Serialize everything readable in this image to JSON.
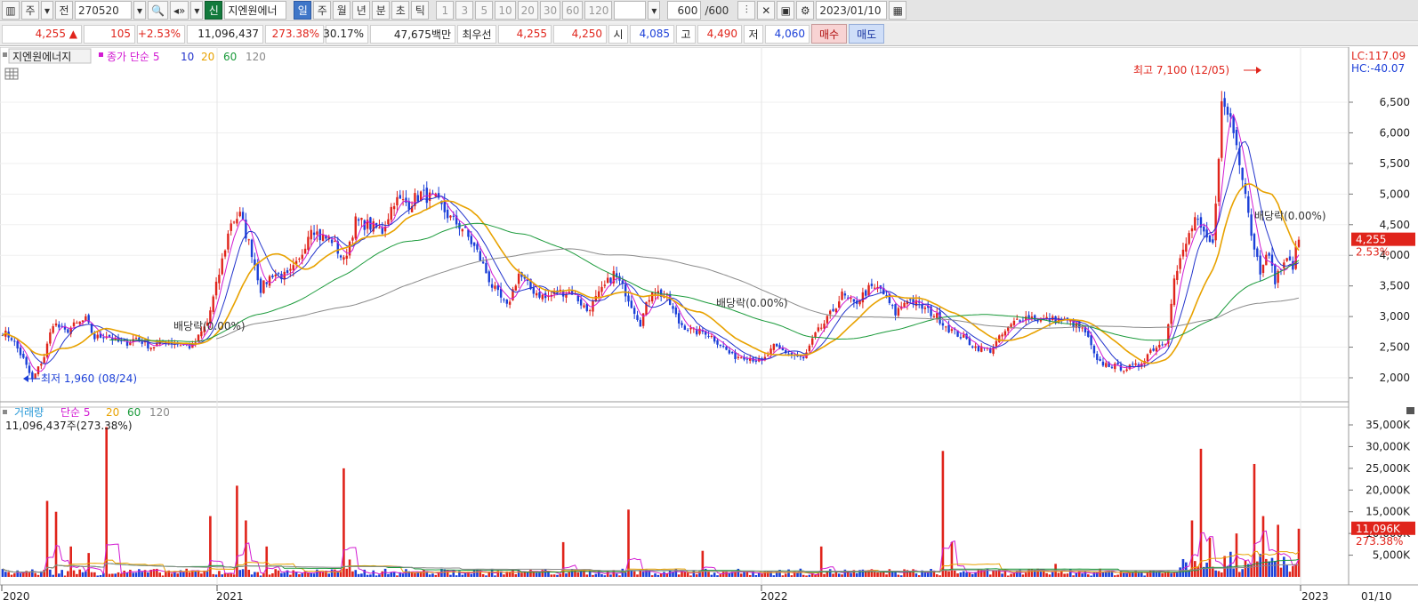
{
  "toolbar": {
    "period_type": "주",
    "prev_label": "전",
    "code": "270520",
    "new_badge": "신",
    "stock_name": "지엔원에너",
    "periods": [
      "일",
      "주",
      "월",
      "년",
      "분",
      "초",
      "틱"
    ],
    "active_period": "일",
    "intervals": [
      "1",
      "3",
      "5",
      "10",
      "20",
      "30",
      "60",
      "120"
    ],
    "count": "600",
    "count_total": "/600",
    "date": "2023/01/10"
  },
  "quote": {
    "price": "4,255",
    "change": "105",
    "change_pct": "+2.53%",
    "volume": "11,096,437",
    "volume_ratio": "273.38%",
    "turnover": "30.17%",
    "amount": "47,675백만",
    "best_bid_label": "최우선",
    "ask": "4,255",
    "bid": "4,250",
    "open_label": "시",
    "open": "4,085",
    "high_label": "고",
    "high": "4,490",
    "low_label": "저",
    "low": "4,060",
    "buy_label": "매수",
    "sell_label": "매도"
  },
  "price_panel": {
    "legend_name": "지엔원에너지",
    "legend_type": "종가 단순",
    "ma_periods": [
      "5",
      "10",
      "20",
      "60",
      "120"
    ],
    "lc": "LC:117.09",
    "hc": "HC:-40.07",
    "current_price": "4,255",
    "current_pct": "2.53%",
    "high_note": "최고 7,100 (12/05)",
    "low_note": "최저 1,960 (08/24)",
    "dividend_note": "배당락(0.00%)",
    "y_ticks": [
      "2,000",
      "2,500",
      "3,000",
      "3,500",
      "4,000",
      "4,500",
      "5,000",
      "5,500",
      "6,000",
      "6,500"
    ]
  },
  "volume_panel": {
    "legend_name": "거래량",
    "legend_type": "단순",
    "ma_periods": [
      "5",
      "20",
      "60",
      "120"
    ],
    "current_text": "11,096,437주(273.38%)",
    "current_vol": "11,096K",
    "current_pct": "273.38%",
    "y_ticks": [
      "5,000K",
      "10,000K",
      "15,000K",
      "20,000K",
      "25,000K",
      "30,000K",
      "35,000K"
    ]
  },
  "x_axis": {
    "labels": [
      "2020",
      "2021",
      "2022",
      "2023"
    ],
    "last_date": "01/10"
  },
  "colors": {
    "up": "#e0241b",
    "down": "#1b3fd8",
    "ma5": "#d21ad2",
    "ma10": "#2233cc",
    "ma20": "#e8a200",
    "ma60": "#1a9a3a",
    "ma120": "#8a8a8a",
    "active": "#3f76c8"
  },
  "chart_data": {
    "type": "candlestick",
    "x_range": [
      "2020-01",
      "2023-01-10"
    ],
    "ylim": [
      1800,
      7400
    ],
    "price_anchors": [
      [
        0,
        2750
      ],
      [
        3,
        2650
      ],
      [
        7,
        2300
      ],
      [
        10,
        1960
      ],
      [
        14,
        2350
      ],
      [
        17,
        2900
      ],
      [
        21,
        2750
      ],
      [
        24,
        2850
      ],
      [
        28,
        2950
      ],
      [
        31,
        2650
      ],
      [
        35,
        2700
      ],
      [
        38,
        2600
      ],
      [
        41,
        2550
      ],
      [
        45,
        2650
      ],
      [
        50,
        2500
      ],
      [
        55,
        2600
      ],
      [
        60,
        2550
      ],
      [
        64,
        2500
      ],
      [
        69,
        2900
      ],
      [
        73,
        3700
      ],
      [
        77,
        4550
      ],
      [
        80,
        4650
      ],
      [
        84,
        4050
      ],
      [
        87,
        3450
      ],
      [
        91,
        3700
      ],
      [
        96,
        3650
      ],
      [
        100,
        3900
      ],
      [
        104,
        4500
      ],
      [
        107,
        4300
      ],
      [
        111,
        4250
      ],
      [
        115,
        3900
      ],
      [
        119,
        4550
      ],
      [
        123,
        4500
      ],
      [
        128,
        4400
      ],
      [
        132,
        4900
      ],
      [
        137,
        4850
      ],
      [
        141,
        5000
      ],
      [
        146,
        4900
      ],
      [
        151,
        4600
      ],
      [
        155,
        4450
      ],
      [
        160,
        4050
      ],
      [
        165,
        3500
      ],
      [
        170,
        3150
      ],
      [
        174,
        3700
      ],
      [
        178,
        3450
      ],
      [
        183,
        3300
      ],
      [
        187,
        3400
      ],
      [
        192,
        3400
      ],
      [
        197,
        3100
      ],
      [
        201,
        3350
      ],
      [
        206,
        3700
      ],
      [
        210,
        3400
      ],
      [
        215,
        2900
      ],
      [
        219,
        3450
      ],
      [
        224,
        3300
      ],
      [
        228,
        2900
      ],
      [
        233,
        2750
      ],
      [
        237,
        2750
      ],
      [
        242,
        2550
      ],
      [
        246,
        2350
      ],
      [
        251,
        2350
      ],
      [
        256,
        2250
      ],
      [
        260,
        2500
      ],
      [
        265,
        2400
      ],
      [
        270,
        2300
      ],
      [
        274,
        2700
      ],
      [
        278,
        2950
      ],
      [
        283,
        3350
      ],
      [
        287,
        3200
      ],
      [
        292,
        3450
      ],
      [
        296,
        3450
      ],
      [
        301,
        3050
      ],
      [
        305,
        3300
      ],
      [
        310,
        3150
      ],
      [
        315,
        3000
      ],
      [
        319,
        2800
      ],
      [
        324,
        2650
      ],
      [
        328,
        2500
      ],
      [
        333,
        2450
      ],
      [
        337,
        2700
      ],
      [
        342,
        2950
      ],
      [
        346,
        3000
      ],
      [
        351,
        2950
      ],
      [
        356,
        2950
      ],
      [
        360,
        2900
      ],
      [
        365,
        2750
      ],
      [
        369,
        2250
      ],
      [
        374,
        2200
      ],
      [
        378,
        2150
      ],
      [
        383,
        2200
      ],
      [
        387,
        2450
      ],
      [
        392,
        2600
      ],
      [
        395,
        3600
      ],
      [
        398,
        4050
      ],
      [
        402,
        4600
      ],
      [
        405,
        4300
      ],
      [
        408,
        4150
      ],
      [
        411,
        6450
      ],
      [
        414,
        6250
      ],
      [
        416,
        5800
      ],
      [
        419,
        5100
      ],
      [
        421,
        4350
      ],
      [
        424,
        3750
      ],
      [
        426,
        4100
      ],
      [
        429,
        3600
      ],
      [
        432,
        3900
      ],
      [
        435,
        3850
      ],
      [
        437,
        4255
      ]
    ],
    "volume_spikes": [
      [
        15,
        17500
      ],
      [
        18,
        15000
      ],
      [
        23,
        7000
      ],
      [
        29,
        5500
      ],
      [
        35,
        34500
      ],
      [
        70,
        14000
      ],
      [
        79,
        21000
      ],
      [
        82,
        13000
      ],
      [
        89,
        7000
      ],
      [
        115,
        25000
      ],
      [
        117,
        4000
      ],
      [
        189,
        8000
      ],
      [
        211,
        15500
      ],
      [
        236,
        6000
      ],
      [
        276,
        7000
      ],
      [
        317,
        29000
      ],
      [
        320,
        8000
      ],
      [
        355,
        3000
      ],
      [
        401,
        13000
      ],
      [
        404,
        29500
      ],
      [
        407,
        9000
      ],
      [
        416,
        10000
      ],
      [
        422,
        26000
      ],
      [
        425,
        14000
      ],
      [
        430,
        12000
      ],
      [
        437,
        11096
      ]
    ]
  }
}
